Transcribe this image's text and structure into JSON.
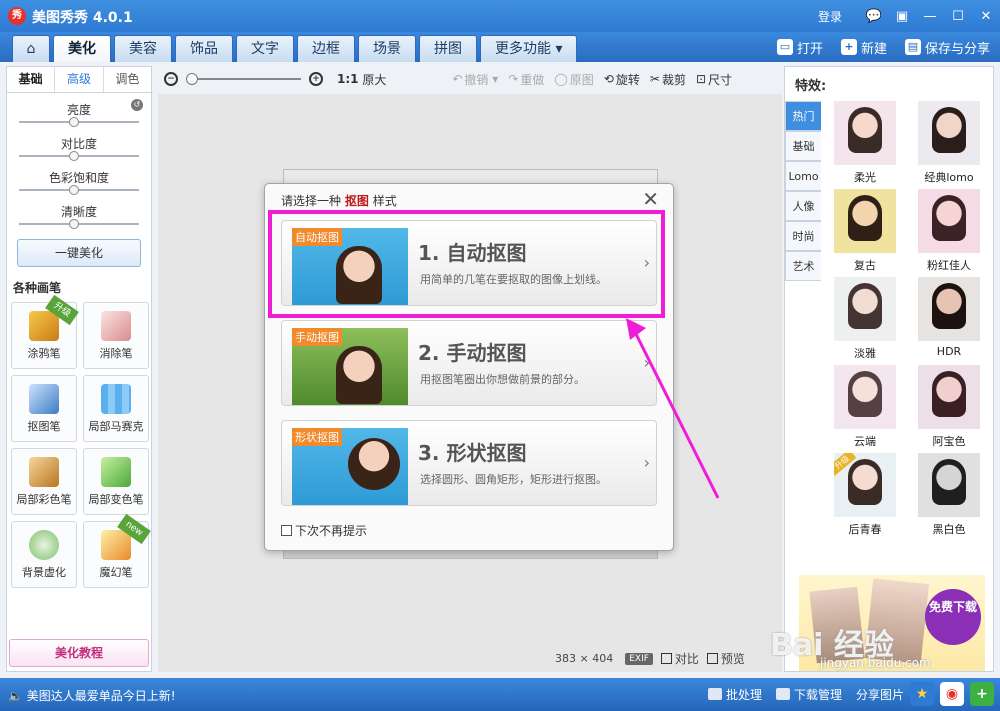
{
  "window": {
    "title": "美图秀秀 4.0.1",
    "logo_text": "秀",
    "login": "登录",
    "controls": [
      "💬",
      "▣",
      "—",
      "☐",
      "✕"
    ]
  },
  "nav": {
    "tabs": [
      "美化",
      "美容",
      "饰品",
      "文字",
      "边框",
      "场景",
      "拼图",
      "更多功能 ▾"
    ],
    "active": "美化",
    "actions": [
      "打开",
      "新建",
      "保存与分享"
    ]
  },
  "left": {
    "subtabs": [
      "基础",
      "高级",
      "调色"
    ],
    "sliders": [
      "亮度",
      "对比度",
      "色彩饱和度",
      "清晰度"
    ],
    "onekey": "一键美化",
    "brushes_title": "各种画笔",
    "brushes": [
      "涂鸦笔",
      "消除笔",
      "抠图笔",
      "局部马赛克",
      "局部彩色笔",
      "局部变色笔",
      "背景虚化",
      "魔幻笔"
    ],
    "badge_upgrade": "升级",
    "badge_new": "new",
    "tutorial": "美化教程"
  },
  "toolbar": {
    "zoom_out": "−",
    "zoom_in": "+",
    "ratio": "1:1",
    "original_size": "原大",
    "undo": "撤销",
    "redo": "重做",
    "original": "原图",
    "rotate": "旋转",
    "crop": "裁剪",
    "size": "尺寸"
  },
  "dialog": {
    "title_prefix": "请选择一种",
    "title_hl": "抠图",
    "title_suffix": "样式",
    "close": "✕",
    "options": [
      {
        "tag": "自动抠图",
        "title": "1. 自动抠图",
        "desc": "用简单的几笔在要抠取的图像上划线。"
      },
      {
        "tag": "手动抠图",
        "title": "2. 手动抠图",
        "desc": "用抠图笔圈出你想做前景的部分。"
      },
      {
        "tag": "形状抠图",
        "title": "3. 形状抠图",
        "desc": "选择圆形、圆角矩形，矩形进行抠图。"
      }
    ],
    "no_prompt": "下次不再提示"
  },
  "status": {
    "width": "383",
    "times": "×",
    "height": "404",
    "exif": "EXIF",
    "compare": "对比",
    "preview": "预览"
  },
  "right": {
    "title": "特效:",
    "categories": [
      "热门",
      "基础",
      "Lomo",
      "人像",
      "时尚",
      "艺术"
    ],
    "active_category": "热门",
    "effects": [
      "柔光",
      "经典lomo",
      "复古",
      "粉红佳人",
      "淡雅",
      "HDR",
      "云端",
      "阿宝色",
      "后青春",
      "黑白色"
    ],
    "ad_text": "免费下载"
  },
  "bottom": {
    "news": "美图达人最爱单品今日上新!",
    "batch": "批处理",
    "download": "下载管理",
    "share": "分享图片"
  },
  "watermark": {
    "logo": "Bai 经验",
    "url": "jingyan.baidu.com"
  },
  "colors": {
    "accent": "#2f7bd3",
    "highlight": "#f01dd6",
    "tag": "#f08a2a"
  }
}
